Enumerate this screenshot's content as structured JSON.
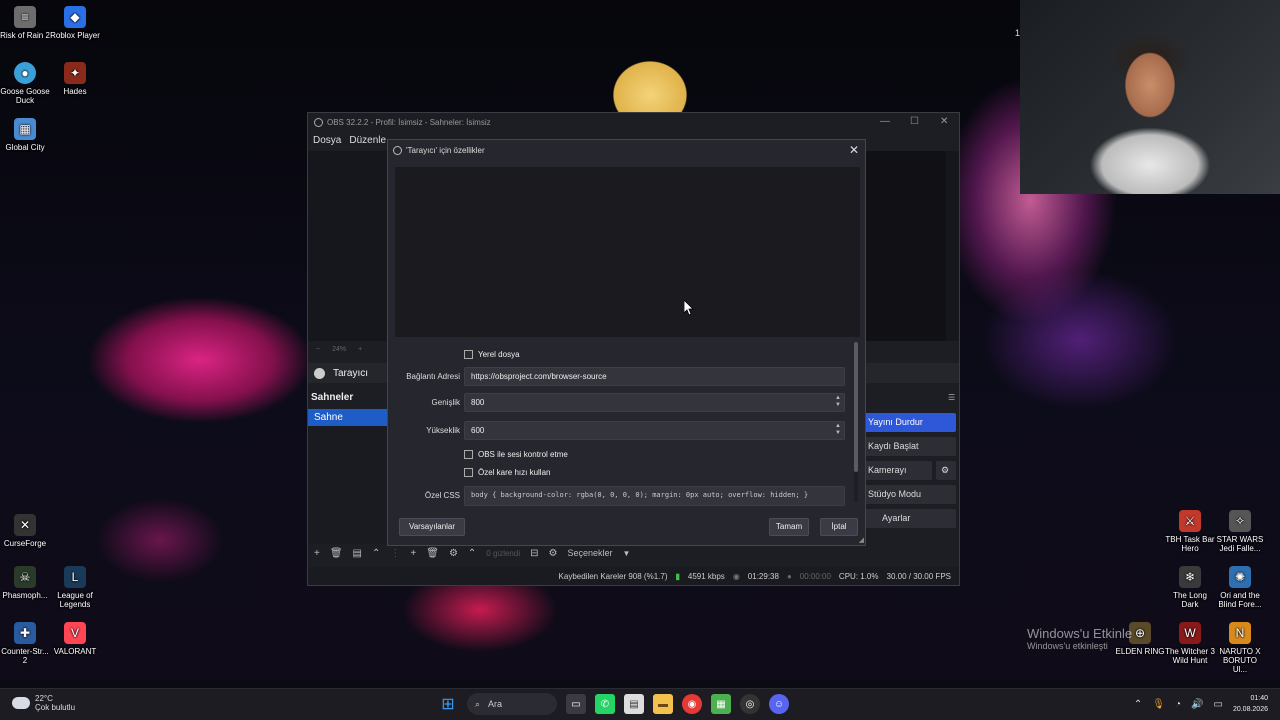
{
  "desktop": {
    "left_icons": [
      {
        "label": "Risk of Rain 2",
        "icon": "game-icon",
        "color": "#6d6d6d"
      },
      {
        "label": "Roblox Player",
        "icon": "roblox-icon",
        "color": "#2b6fe6"
      },
      {
        "label": "Goose Goose Duck",
        "icon": "goose-icon",
        "color": "#3ba0d8"
      },
      {
        "label": "Hades",
        "icon": "hades-icon",
        "color": "#8a2a1a"
      },
      {
        "label": "Global City",
        "icon": "city-icon",
        "color": "#4a8ad0"
      },
      {
        "label": "CurseForge",
        "icon": "curseforge-icon",
        "color": "#333"
      },
      {
        "label": "Phasmoph...",
        "icon": "phasmophobia-icon",
        "color": "#2a3b2a"
      },
      {
        "label": "League of Legends",
        "icon": "lol-icon",
        "color": "#1a3a5a"
      },
      {
        "label": "Counter-Str... 2",
        "icon": "cs2-icon",
        "color": "#2a5aa0"
      },
      {
        "label": "VALORANT",
        "icon": "valorant-icon",
        "color": "#ff4655"
      }
    ],
    "right_icons": [
      {
        "label": "TBH Task Bar Hero",
        "icon": "tbh-icon",
        "color": "#c0392b"
      },
      {
        "label": "STAR WARS Jedi Falle...",
        "icon": "starwars-icon",
        "color": "#555"
      },
      {
        "label": "The Long Dark",
        "icon": "longdark-icon",
        "color": "#3a3a3a"
      },
      {
        "label": "Ori and the Blind Fore...",
        "icon": "ori-icon",
        "color": "#2d6fb0"
      },
      {
        "label": "ELDEN RING",
        "icon": "eldenring-icon",
        "color": "#5a4a2a"
      },
      {
        "label": "The Witcher 3 Wild Hunt",
        "icon": "witcher-icon",
        "color": "#8a1a1a"
      },
      {
        "label": "NARUTO X BORUTO Ul...",
        "icon": "naruto-icon",
        "color": "#d88a1a"
      }
    ],
    "top_right_marker": "1"
  },
  "obs": {
    "title": "OBS 32.2.2 - Profil: İsimsiz - Sahneler: İsimsiz",
    "menu": {
      "file": "Dosya",
      "edit": "Düzenle"
    },
    "source_label": "Tarayıcı",
    "zoom": "24%",
    "scenes_header": "Sahneler",
    "scene_selected": "Sahne",
    "controls": {
      "stop_stream": "Yayını Durdur",
      "start_record": "Kaydı Başlat",
      "start_virtualcam": "Kamerayı Başlat",
      "studio_mode": "Stüdyo Modu",
      "settings": "Ayarlar"
    },
    "bottom_toolbar": {
      "hidden_count": "0 gizlendi",
      "options": "Seçenekler"
    },
    "status": {
      "dropped_frames": "Kaybedilen Kareler 908 (%1.7)",
      "bitrate": "4591 kbps",
      "stream_time": "01:29:38",
      "record_time": "00:00:00",
      "cpu": "CPU: 1.0%",
      "fps": "30.00 / 30.00 FPS"
    }
  },
  "dialog": {
    "title": "'Tarayıcı' için özellikler",
    "local_file_label": "Yerel dosya",
    "url_label": "Bağlantı Adresi",
    "url_value": "https://obsproject.com/browser-source",
    "width_label": "Genişlik",
    "width_value": "800",
    "height_label": "Yükseklik",
    "height_value": "600",
    "obs_audio_label": "OBS ile sesi kontrol etme",
    "custom_fps_label": "Özel kare hızı kullan",
    "css_label": "Özel CSS",
    "css_value": "body { background-color: rgba(0, 0, 0, 0); margin: 0px auto; overflow: hidden; }",
    "defaults_button": "Varsayılanlar",
    "ok_button": "Tamam",
    "cancel_button": "İptal"
  },
  "watermark": {
    "line1": "Windows'u Etkinle",
    "line2": "Windows'u etkinleşti"
  },
  "taskbar": {
    "temperature": "22°C",
    "weather": "Çok bulutlu",
    "search_placeholder": "Ara",
    "time": "01:40",
    "date": "20.08.2026"
  },
  "colors": {
    "accent_blue": "#2f58d8",
    "obs_bg": "#1d1e24",
    "dialog_bg": "#26272e",
    "bitrate_green": "#45c04a"
  }
}
